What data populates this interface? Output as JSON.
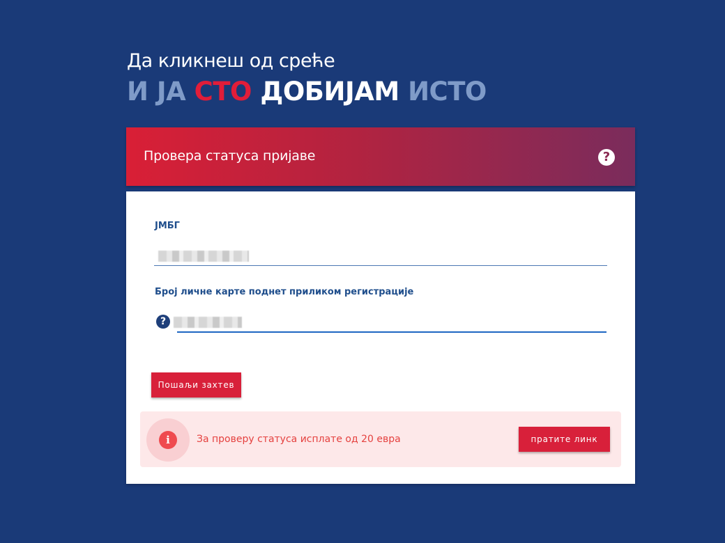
{
  "hero": {
    "subtitle": "Да кликнеш од среће",
    "title_words": [
      "И ЈА",
      "СТО",
      "ДОБИЈАМ",
      "ИСТО"
    ]
  },
  "card": {
    "title": "Провера статуса пријаве",
    "help_icon": "question-icon"
  },
  "form": {
    "jmbg_label": "ЈМБГ",
    "jmbg_value": "",
    "id_label": "Број личне карте поднет приликом регистрације",
    "id_value": "",
    "id_help_icon": "question-icon",
    "submit_label": "Пошаљи захтев"
  },
  "notice": {
    "icon": "info-icon",
    "text": "За проверу статуса исплате од 20 евра",
    "button_label": "пратите линк"
  },
  "colors": {
    "background": "#1a3a78",
    "accent_red": "#d8203a",
    "label_blue": "#1f4e8c",
    "notice_bg": "#fde8e9",
    "notice_text": "#e5413f"
  }
}
